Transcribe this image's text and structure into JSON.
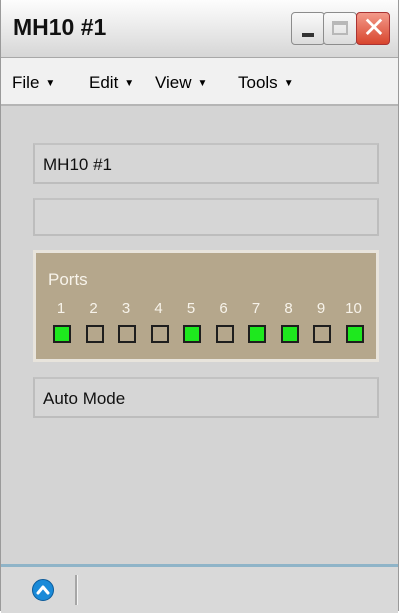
{
  "window": {
    "title": "MH10 #1"
  },
  "title_buttons": {
    "close_glyph": "✕"
  },
  "menu": {
    "items": [
      {
        "label": "File"
      },
      {
        "label": "Edit"
      },
      {
        "label": "View"
      },
      {
        "label": "Tools"
      }
    ],
    "arrow": "▼"
  },
  "device": {
    "name": "MH10 #1",
    "info": "",
    "mode": "Auto Mode"
  },
  "ports": {
    "title": "Ports",
    "items": [
      {
        "label": "1",
        "active": true
      },
      {
        "label": "2",
        "active": false
      },
      {
        "label": "3",
        "active": false
      },
      {
        "label": "4",
        "active": false
      },
      {
        "label": "5",
        "active": true
      },
      {
        "label": "6",
        "active": false
      },
      {
        "label": "7",
        "active": true
      },
      {
        "label": "8",
        "active": true
      },
      {
        "label": "9",
        "active": false
      },
      {
        "label": "10",
        "active": true
      }
    ],
    "active_color": "#1ee81e",
    "panel_color": "#b5a78c"
  },
  "statusbar": {
    "icon": "chevron-up-circle-icon",
    "icon_color": "#1a8ad8"
  }
}
